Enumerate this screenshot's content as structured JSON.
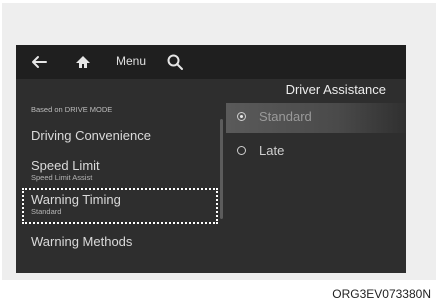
{
  "topbar": {
    "back_icon": "back-arrow-icon",
    "home_icon": "home-icon",
    "menu_label": "Menu",
    "search_icon": "search-icon"
  },
  "panel": {
    "title": "Driver Assistance"
  },
  "left_menu": {
    "caption": "Based on DRIVE MODE",
    "items": [
      {
        "label": "Driving Convenience",
        "sub": ""
      },
      {
        "label": "Speed Limit",
        "sub": "Speed Limit Assist"
      },
      {
        "label": "Warning Timing",
        "sub": "Standard",
        "focused": true
      },
      {
        "label": "Warning Methods",
        "sub": ""
      }
    ]
  },
  "options": [
    {
      "label": "Standard",
      "selected": true
    },
    {
      "label": "Late",
      "selected": false
    }
  ],
  "figure_code": "ORG3EV073380N"
}
